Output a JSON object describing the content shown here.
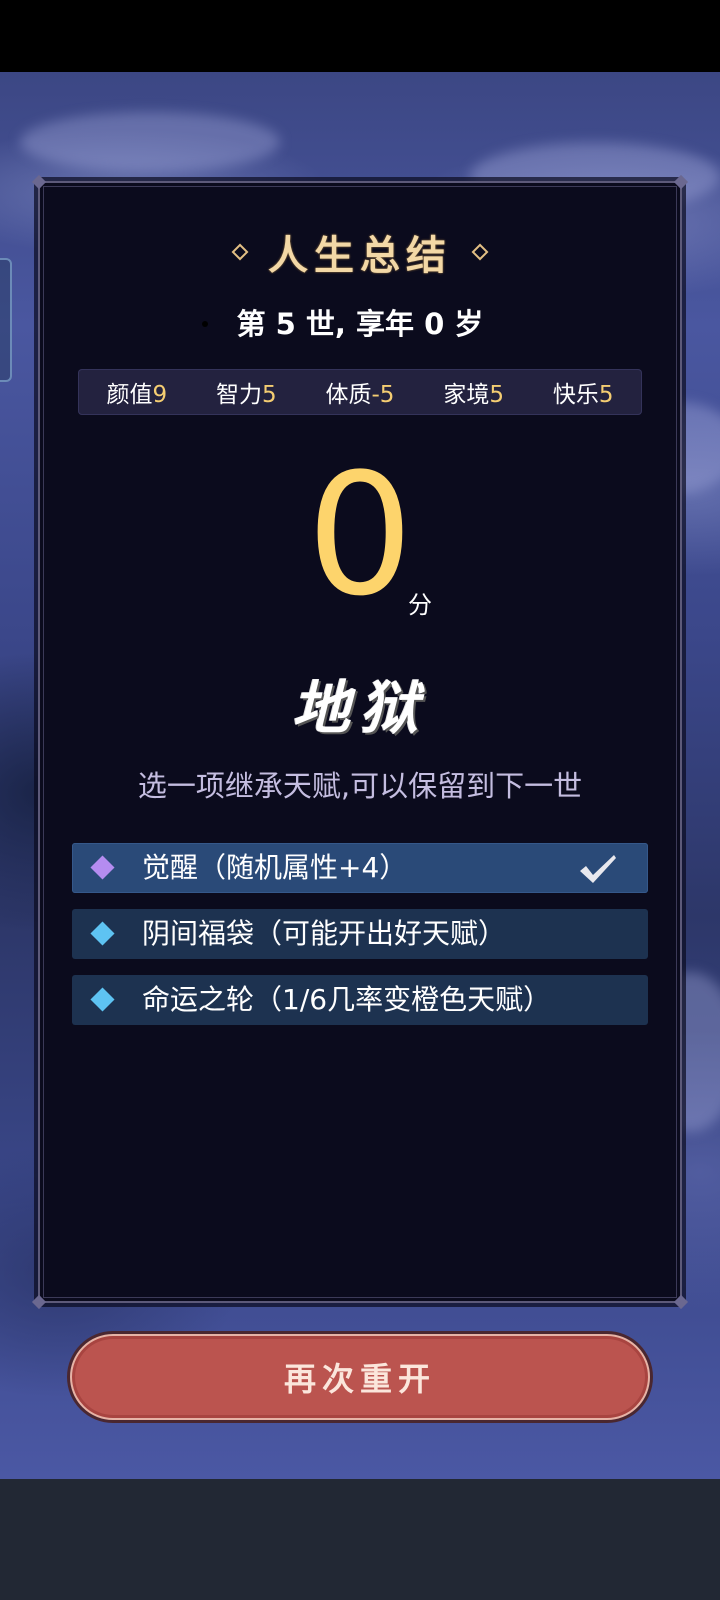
{
  "summary": {
    "title": "人生总结",
    "life_line": "第 5 世, 享年 0 岁"
  },
  "stats": [
    {
      "name": "颜值",
      "value": "9"
    },
    {
      "name": "智力",
      "value": "5"
    },
    {
      "name": "体质",
      "value": "-5"
    },
    {
      "name": "家境",
      "value": "5"
    },
    {
      "name": "快乐",
      "value": "5"
    }
  ],
  "score": {
    "value": "0",
    "unit": "分",
    "grade": "地狱"
  },
  "inherit": {
    "prompt": "选一项继承天赋,可以保留到下一世",
    "options": [
      {
        "label": "觉醒（随机属性+4）",
        "diamond_color": "#b58cf0",
        "selected": true
      },
      {
        "label": "阴间福袋（可能开出好天赋）",
        "diamond_color": "#5ec3f2",
        "selected": false
      },
      {
        "label": "命运之轮（1/6几率变橙色天赋）",
        "diamond_color": "#5ec3f2",
        "selected": false
      }
    ]
  },
  "restart_button": {
    "label": "再次重开",
    "color": "#bb544f"
  },
  "icons": {
    "check": "check-icon",
    "diamond": "diamond-icon"
  }
}
